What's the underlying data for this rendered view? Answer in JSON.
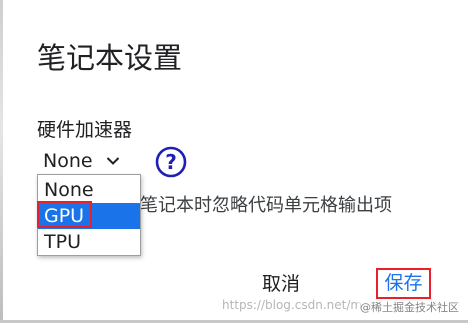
{
  "dialog": {
    "title": "笔记本设置",
    "hardware_label": "硬件加速器",
    "selected_value": "None",
    "options": [
      "None",
      "GPU",
      "TPU"
    ],
    "highlighted_option": "GPU",
    "omit_text": "笔记本时忽略代码单元格输出项",
    "cancel_label": "取消",
    "save_label": "保存"
  },
  "icons": {
    "dropdown": "chevron-down-icon",
    "help": "help-icon"
  },
  "colors": {
    "accent": "#1a73e8",
    "highlight_box": "#e8202e"
  },
  "watermark": {
    "url": "https://blog.csdn.net/m",
    "site": "@稀土掘金技术社区"
  }
}
